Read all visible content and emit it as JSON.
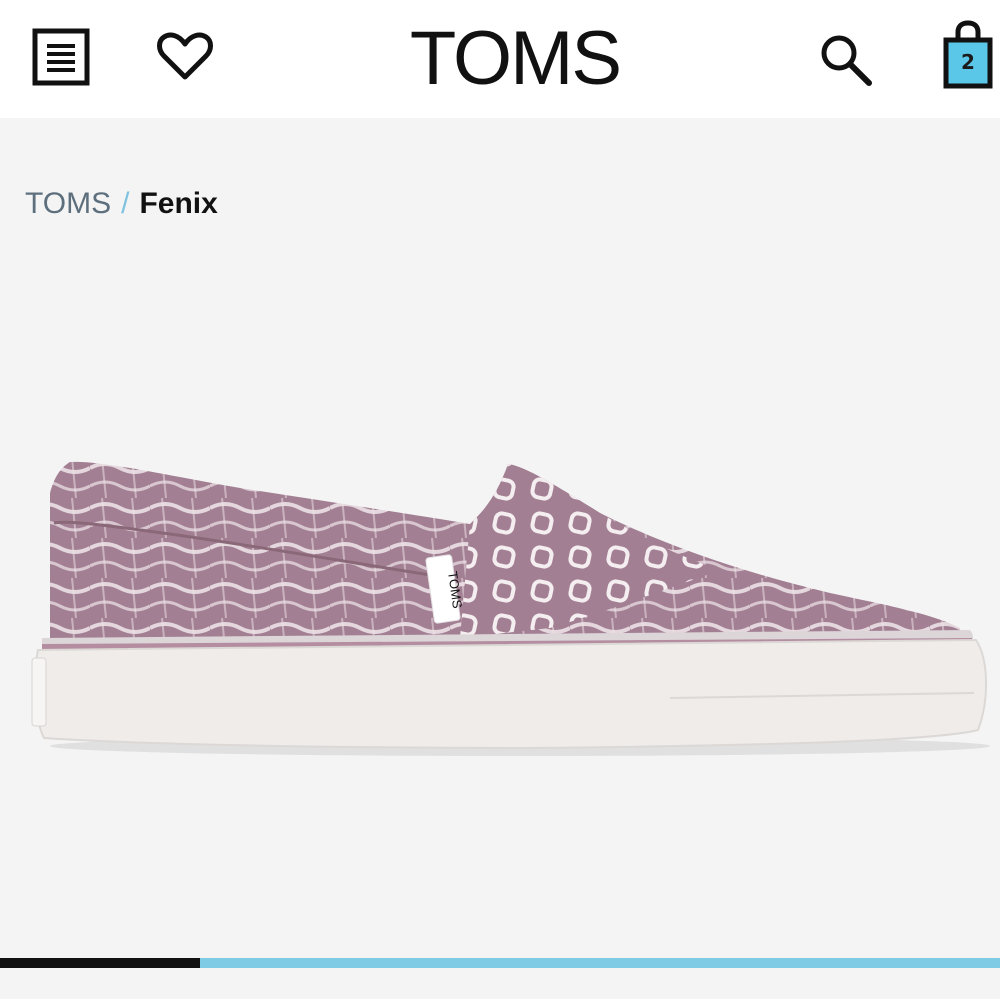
{
  "header": {
    "logo": "TOMS",
    "menu_icon": "menu-icon",
    "wishlist_icon": "heart-icon",
    "search_icon": "search-icon",
    "bag_icon": "shopping-bag-icon",
    "bag_count": "2",
    "bag_color": "#5bc7e8"
  },
  "breadcrumb": {
    "home": "TOMS",
    "separator": "/",
    "current": "Fenix"
  },
  "product": {
    "tongue_label": "TOMS",
    "upper_color": "#a37f93",
    "sole_color": "#efecea"
  },
  "gallery": {
    "progress": 0.2,
    "track_color": "#7fcbe6",
    "fill_color": "#111111"
  }
}
